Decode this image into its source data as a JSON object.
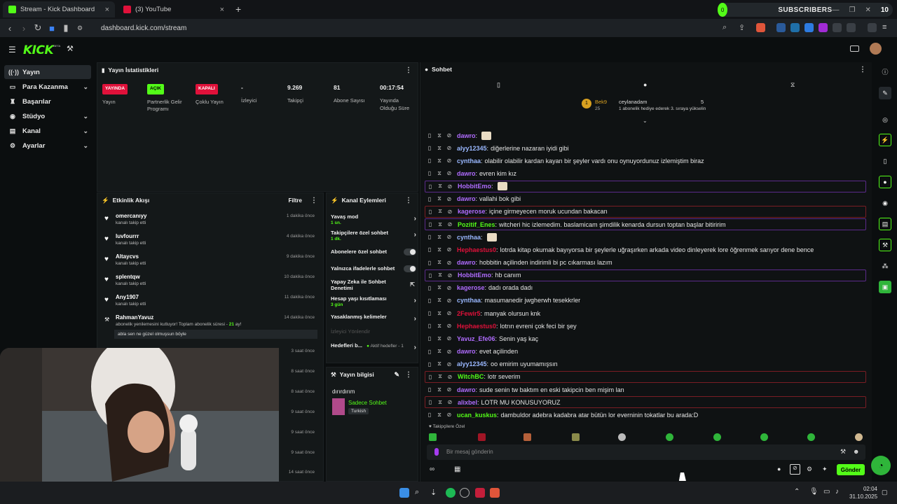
{
  "browser": {
    "tabs": [
      {
        "title": "Stream - Kick Dashboard",
        "active": true
      },
      {
        "title": "(3) YouTube",
        "active": false
      }
    ],
    "new_tab": "+",
    "url": "dashboard.kick.com/stream",
    "subs_widget": {
      "label": "SUBSCRIBERS",
      "count": "10",
      "circle": "0"
    }
  },
  "kick": {
    "logo": "KICK",
    "beta": "BETA"
  },
  "sidebar": {
    "items": [
      {
        "label": "Yayın",
        "icon": "broadcast-icon",
        "chevron": false
      },
      {
        "label": "Para Kazanma",
        "icon": "money-icon",
        "chevron": true
      },
      {
        "label": "Başarılar",
        "icon": "trophy-icon",
        "chevron": false
      },
      {
        "label": "Stüdyo",
        "icon": "studio-icon",
        "chevron": true
      },
      {
        "label": "Kanal",
        "icon": "channel-icon",
        "chevron": true
      },
      {
        "label": "Ayarlar",
        "icon": "settings-icon",
        "chevron": true
      }
    ]
  },
  "stats_panel": {
    "title": "Yayın İstatistikleri",
    "items": [
      {
        "badge": "YAYINDA",
        "badge_color": "#e0113a",
        "label": "Yayın"
      },
      {
        "badge": "AÇIK",
        "badge_color": "#53fc18",
        "label": "Partnerlik Gelir Programı"
      },
      {
        "badge": "KAPALI",
        "badge_color": "#e0113a",
        "label": "Çoklu Yayın"
      },
      {
        "value": "-",
        "label": "İzleyici"
      },
      {
        "value": "9.269",
        "label": "Takipçi"
      },
      {
        "value": "81",
        "label": "Abone Sayısı"
      },
      {
        "value": "00:17:54",
        "label": "Yayında Olduğu Süre"
      }
    ]
  },
  "activity": {
    "title": "Etkinlik Akışı",
    "filter": "Filtre",
    "rows": [
      {
        "name": "omercanıyy",
        "sub": "kanalı takip etti",
        "time": "1 dakika önce"
      },
      {
        "name": "luvfourrr",
        "sub": "kanalı takip etti",
        "time": "4 dakika önce"
      },
      {
        "name": "Altaycvs",
        "sub": "kanalı takip etti",
        "time": "9 dakika önce"
      },
      {
        "name": "splentqw",
        "sub": "kanalı takip etti",
        "time": "10 dakika önce"
      },
      {
        "name": "Any1907",
        "sub": "kanalı takip etti",
        "time": "11 dakika önce"
      }
    ],
    "sub_row": {
      "name": "RahmanYavuz",
      "text": "abonelik yenilemesini kutluyor! Toplam abonelik süresi -",
      "months": "21",
      "months_suffix": "ay!",
      "time": "14 dakika önce",
      "message": "abla sen ne güzel olmuşsun böyle"
    },
    "more_times": [
      "3 saat önce",
      "8 saat önce",
      "8 saat önce",
      "9 saat önce",
      "9 saat önce",
      "9 saat önce",
      "14 saat önce"
    ]
  },
  "channel_actions": {
    "title": "Kanal Eylemleri",
    "items": [
      {
        "label": "Yavaş mod",
        "sub": "1 sn.",
        "control": "arrow"
      },
      {
        "label": "Takipçilere özel sohbet",
        "sub": "1 dk.",
        "control": "arrow"
      },
      {
        "label": "Abonelere özel sohbet",
        "sub": "",
        "control": "toggle"
      },
      {
        "label": "Yalnızca ifadelerle sohbet",
        "sub": "",
        "control": "toggle"
      },
      {
        "label": "Yapay Zeka ile Sohbet Denetimi",
        "sub": "",
        "control": "external"
      },
      {
        "label": "Hesap yaşı kısıtlaması",
        "sub": "3 gün",
        "control": "arrow"
      },
      {
        "label": "Yasaklanmış kelimeler",
        "sub": "",
        "control": "arrow"
      }
    ],
    "disabled_item": "İzleyici Yönlendir",
    "goals": {
      "label": "Hedefleri b...",
      "status": "Aktif hedefler - 1"
    }
  },
  "stream_info": {
    "title": "Yayın bilgisi",
    "stream_title": "dırırdırım",
    "category": "Sadece Sohbet",
    "language": "Turkish"
  },
  "chat": {
    "title": "Sohbet",
    "pinned": {
      "user1": "Bek9",
      "user1_count": "25",
      "user2": "ceylanadam",
      "user2_count": "5",
      "text": "1 abonelik hediye ederek 3. sıraya yükselin"
    },
    "messages": [
      {
        "user": "dawro",
        "color": "#b06cff",
        "text": "",
        "emote": true,
        "hl": ""
      },
      {
        "user": "alyy12345",
        "color": "#9ab8ff",
        "text": "diğerlerine nazaran iyidi gibi",
        "emote": false,
        "hl": ""
      },
      {
        "user": "cynthaa",
        "color": "#9ab8ff",
        "text": "olabilir olabilir kardan kayan bir şeyler vardı onu oynuyordunuz izlemiştim biraz",
        "emote": false,
        "hl": ""
      },
      {
        "user": "dawro",
        "color": "#b06cff",
        "text": "evren kim kız",
        "emote": false,
        "hl": ""
      },
      {
        "user": "HobbitEmo",
        "color": "#b06cff",
        "text": "",
        "emote": true,
        "hl": "purple"
      },
      {
        "user": "dawro",
        "color": "#b06cff",
        "text": "vallahi bok gibi",
        "emote": false,
        "hl": ""
      },
      {
        "user": "kagerose",
        "color": "#b06cff",
        "text": "içine girmeyecen moruk ucundan bakacan",
        "emote": false,
        "hl": "red"
      },
      {
        "user": "Pozitif_Enes",
        "color": "#53fc18",
        "text": "witcheri hic izlemedim. baslamicam şimdilik kenarda dursun toptan başlar bitiririm",
        "emote": false,
        "hl": "purple"
      },
      {
        "user": "cynthaa",
        "color": "#9ab8ff",
        "text": "",
        "emote": true,
        "hl": ""
      },
      {
        "user": "Hephaestus0",
        "color": "#e0113a",
        "text": "lotrda kitap okumak bayıyorsa bir şeylerle uğraşırken arkada video dinleyerek lore öğrenmek sarıyor dene bence",
        "emote": false,
        "hl": ""
      },
      {
        "user": "dawro",
        "color": "#b06cff",
        "text": "hobbitin açilinden indirimli bi pc cıkarması lazım",
        "emote": false,
        "hl": ""
      },
      {
        "user": "HobbitEmo",
        "color": "#b06cff",
        "text": "hb canım",
        "emote": false,
        "hl": "purple"
      },
      {
        "user": "kagerose",
        "color": "#b06cff",
        "text": "dadı orada dadı",
        "emote": false,
        "hl": ""
      },
      {
        "user": "cynthaa",
        "color": "#9ab8ff",
        "text": "masumanedir jwgherwh tesekkrler",
        "emote": false,
        "hl": ""
      },
      {
        "user": "2Fewir5",
        "color": "#e0113a",
        "text": "manyak olursun knk",
        "emote": false,
        "hl": ""
      },
      {
        "user": "Hephaestus0",
        "color": "#e0113a",
        "text": "lotrın evreni çok feci bir şey",
        "emote": false,
        "hl": ""
      },
      {
        "user": "Yavuz_Efe06",
        "color": "#b06cff",
        "text": "Senin yaş kaç",
        "emote": false,
        "hl": ""
      },
      {
        "user": "dawro",
        "color": "#b06cff",
        "text": "evet açilinden",
        "emote": false,
        "hl": ""
      },
      {
        "user": "alyy12345",
        "color": "#9ab8ff",
        "text": "oo emirim uyumamışsın",
        "emote": false,
        "hl": ""
      },
      {
        "user": "WitchBC",
        "color": "#53fc18",
        "text": "lotr severim",
        "emote": false,
        "hl": "red"
      },
      {
        "user": "dawro",
        "color": "#b06cff",
        "text": "sude senin tw baktım en eski takipcin ben mişim lan",
        "emote": false,
        "hl": ""
      },
      {
        "user": "alixbel",
        "color": "#b06cff",
        "text": "LOTR MU KONUSUYORUZ",
        "emote": false,
        "hl": "red"
      },
      {
        "user": "ucan_kuskus",
        "color": "#53fc18",
        "text": "dambuldor adebra kadabra atar bütün lor everninin tokatlar bu arada:D",
        "emote": false,
        "hl": ""
      }
    ],
    "followers_only": "Takipçilere Özel",
    "input_placeholder": "Bir mesaj gönderin",
    "send": "Gönder"
  },
  "taskbar": {
    "time": "02:04",
    "date": "31.10.2025"
  },
  "colors": {
    "brand": "#53fc18",
    "live": "#e0113a",
    "bg": "#0b0e0f",
    "panel": "#141819"
  }
}
